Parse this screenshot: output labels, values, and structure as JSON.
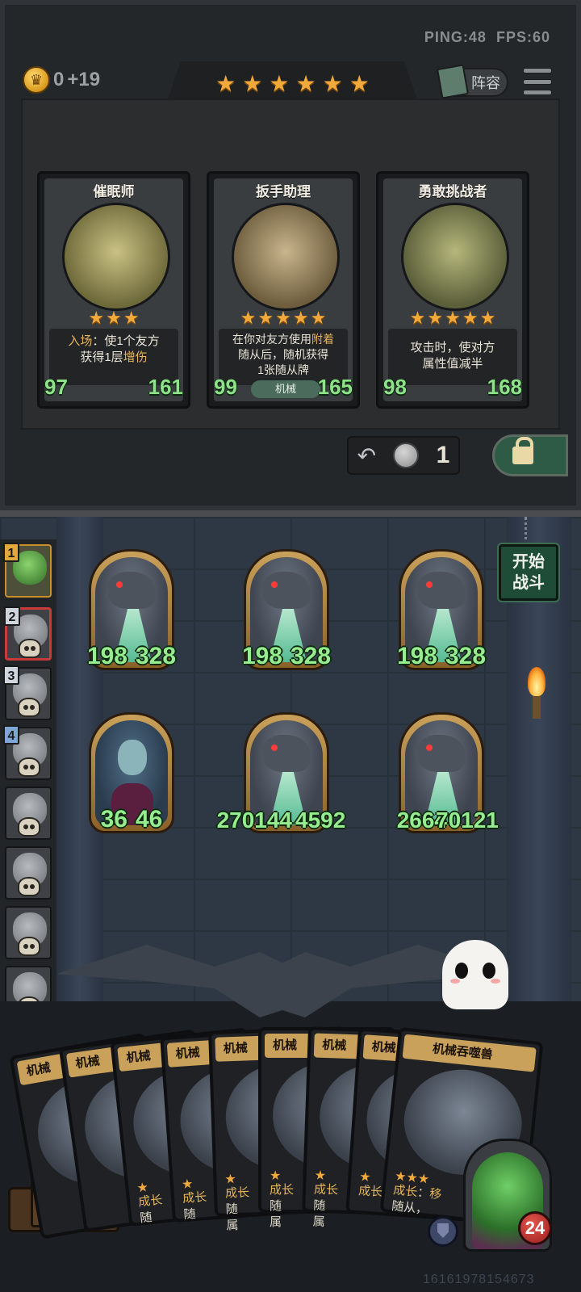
{
  "status": {
    "ping": "PING:48",
    "fps": "FPS:60"
  },
  "gold": {
    "amount": "0",
    "income": "+19"
  },
  "tavern_stars": 6,
  "buttons": {
    "lineup": "阵容",
    "start_battle_l1": "开始",
    "start_battle_l2": "战斗",
    "refresh_cost": "1"
  },
  "shop_cards": [
    {
      "name": "催眠师",
      "stars": 3,
      "desc_pre": "入场",
      "desc_mid": "：使1个友方\n获得1层",
      "desc_hl": "增伤",
      "attack": "97",
      "health": "161"
    },
    {
      "name": "扳手助理",
      "stars": 5,
      "desc_pre": "在你对友方使用",
      "desc_hl1": "附着",
      "desc_post": "随从后，随机获得\n1张随从牌",
      "tribe": "机械",
      "attack": "99",
      "health": "165"
    },
    {
      "name": "勇敢挑战者",
      "stars": 5,
      "desc": "攻击时，使对方\n属性值减半",
      "attack": "98",
      "health": "168"
    }
  ],
  "board_minions": [
    {
      "kind": "mech",
      "attack": "198",
      "health": "328"
    },
    {
      "kind": "mech",
      "attack": "198",
      "health": "328"
    },
    {
      "kind": "mech",
      "attack": "198",
      "health": "328"
    },
    {
      "kind": "elf",
      "attack": "36",
      "health": "46"
    },
    {
      "kind": "mech",
      "attack": "270144",
      "health": "4592"
    },
    {
      "kind": "mech",
      "attack": "2664",
      "health": "70121"
    }
  ],
  "roster": [
    {
      "num": "1",
      "state": "active",
      "num_color": "#e0a93a"
    },
    {
      "num": "2",
      "state": "target",
      "num_color": "#cfd6de"
    },
    {
      "num": "3",
      "state": "dead",
      "num_color": "#cfd6de"
    },
    {
      "num": "4",
      "state": "dead",
      "num_color": "#7fa7d6"
    },
    {
      "num": "",
      "state": "dead"
    },
    {
      "num": "",
      "state": "dead"
    },
    {
      "num": "",
      "state": "dead"
    },
    {
      "num": "",
      "state": "dead"
    }
  ],
  "hand": {
    "card_name_short": "机械",
    "front_card_name": "机械吞噬兽",
    "front_text_a": "成长",
    "front_text_b": "：",
    "front_text_c": "移",
    "front_text_d": "随从，",
    "back_text_a": "成长",
    "back_text_b": "随",
    "back_text_c": "属"
  },
  "hero": {
    "health": "24"
  },
  "uid": "16161978154673"
}
